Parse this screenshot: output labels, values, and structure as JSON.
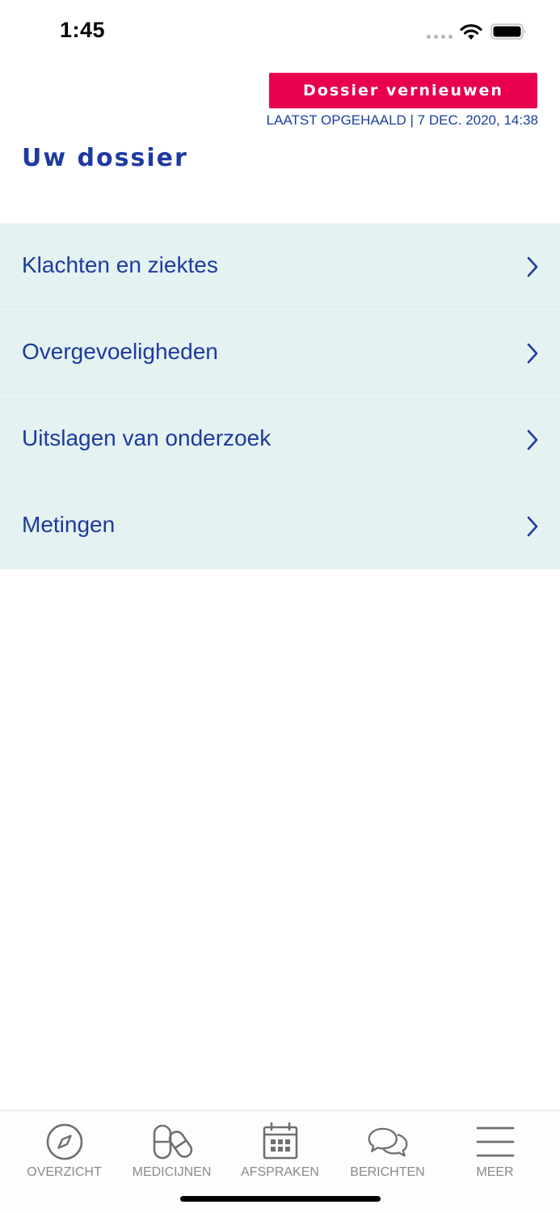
{
  "status_bar": {
    "time": "1:45"
  },
  "header": {
    "renew_button_label": "Dossier vernieuwen",
    "last_fetched": "LAATST OPGEHAALD | 7 DEC. 2020, 14:38",
    "title": "Uw dossier"
  },
  "dossier_items": [
    {
      "label": "Klachten en ziektes",
      "icon": "chevron-right-icon"
    },
    {
      "label": "Overgevoeligheden",
      "icon": "chevron-right-icon"
    },
    {
      "label": "Uitslagen van onderzoek",
      "icon": "chevron-right-icon"
    },
    {
      "label": "Metingen",
      "icon": "chevron-right-icon"
    }
  ],
  "tabs": [
    {
      "label": "OVERZICHT",
      "icon": "compass-icon"
    },
    {
      "label": "MEDICIJNEN",
      "icon": "pills-icon"
    },
    {
      "label": "AFSPRAKEN",
      "icon": "calendar-icon"
    },
    {
      "label": "BERICHTEN",
      "icon": "chat-bubbles-icon"
    },
    {
      "label": "MEER",
      "icon": "menu-icon"
    }
  ],
  "colors": {
    "accent": "#e8004f",
    "primary_text": "#1e3aa0",
    "list_background": "#e4f2f1",
    "tab_inactive": "#8a8a8a"
  }
}
